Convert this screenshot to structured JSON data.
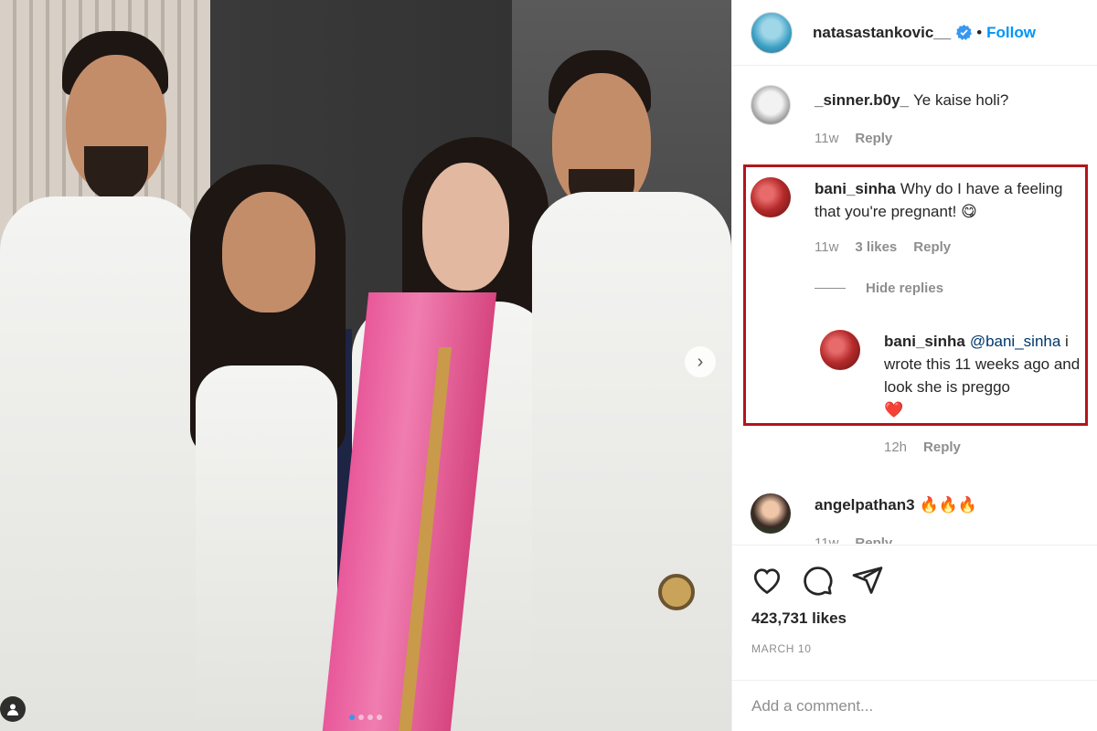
{
  "post": {
    "owner": "natasastankovic__",
    "follow_label": "Follow",
    "dot": "•"
  },
  "comments": [
    {
      "user": "_sinner.b0y_",
      "text": "Ye kaise holi?",
      "time": "11w",
      "reply_label": "Reply"
    },
    {
      "user": "bani_sinha",
      "text": "Why do I have a feeling that you're pregnant! 😋",
      "time": "11w",
      "likes": "3 likes",
      "reply_label": "Reply"
    }
  ],
  "hide_replies_label": "Hide replies",
  "reply": {
    "user": "bani_sinha",
    "mention": "@bani_sinha",
    "text": " i wrote this 11 weeks ago and look she is preggo",
    "heart": "❤️",
    "time": "12h",
    "reply_label": "Reply"
  },
  "third_comment": {
    "user": "angelpathan3",
    "text": "🔥🔥🔥",
    "time": "11w",
    "reply_label": "Reply"
  },
  "actions": {
    "icons": [
      "heart-icon",
      "comment-icon",
      "share-icon"
    ],
    "likes": "423,731 likes",
    "date": "MARCH 10"
  },
  "add_comment": {
    "placeholder": "Add a comment..."
  },
  "photo": {
    "next_arrow": "›"
  },
  "colors": {
    "accent": "#0095f6",
    "highlight": "#b3151b",
    "verified": "#3897f0"
  }
}
